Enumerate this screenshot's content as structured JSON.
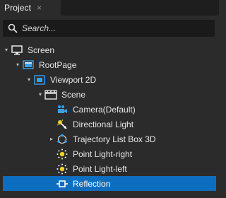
{
  "tab": {
    "title": "Project",
    "close_glyph": "×"
  },
  "search": {
    "placeholder": "Search...",
    "value": ""
  },
  "tree": [
    {
      "label": "Screen",
      "icon": "monitor-icon",
      "expander": "▾",
      "selected": false
    },
    {
      "label": "RootPage",
      "icon": "page-icon",
      "expander": "▾",
      "selected": false
    },
    {
      "label": "Viewport 2D",
      "icon": "viewport-icon",
      "expander": "▾",
      "selected": false
    },
    {
      "label": "Scene",
      "icon": "scene-icon",
      "expander": "▾",
      "selected": false
    },
    {
      "label": "Camera(Default)",
      "icon": "camera-icon",
      "expander": "",
      "selected": false
    },
    {
      "label": "Directional Light",
      "icon": "directional-light-icon",
      "expander": "",
      "selected": false
    },
    {
      "label": "Trajectory List Box 3D",
      "icon": "trajectory-list-icon",
      "expander": "▸",
      "selected": false
    },
    {
      "label": "Point Light-right",
      "icon": "point-light-icon",
      "expander": "",
      "selected": false
    },
    {
      "label": "Point Light-left",
      "icon": "point-light-icon",
      "expander": "",
      "selected": false
    },
    {
      "label": "Reflection",
      "icon": "reflection-icon",
      "expander": "",
      "selected": true
    }
  ],
  "colors": {
    "selection": "#0d6ebf",
    "icon_blue": "#3aa0e8",
    "icon_yellow": "#f2cf2e"
  }
}
